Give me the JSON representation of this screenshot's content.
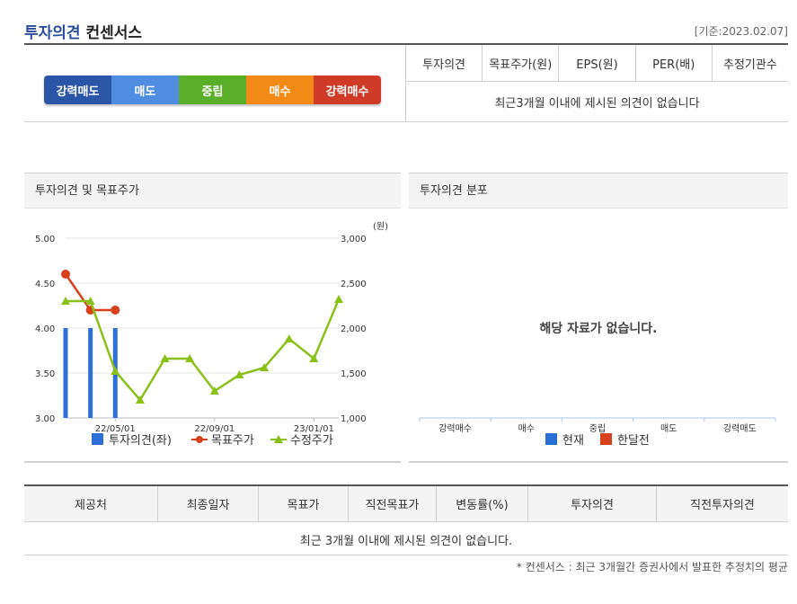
{
  "header": {
    "title_part1": "투자의견",
    "title_part2": "컨센서스",
    "date": "[기준:2023.02.07]"
  },
  "opinion_scale": [
    {
      "label": "강력매도",
      "color": "#2b56a8"
    },
    {
      "label": "매도",
      "color": "#4f8de0"
    },
    {
      "label": "중립",
      "color": "#5aae2a"
    },
    {
      "label": "매수",
      "color": "#f38a17"
    },
    {
      "label": "강력매수",
      "color": "#cf3b28"
    }
  ],
  "top_table": {
    "headers": [
      "투자의견",
      "목표주가(원)",
      "EPS(원)",
      "PER(배)",
      "추정기관수"
    ],
    "message": "최근3개월 이내에 제시된 의견이 없습니다"
  },
  "left_panel": {
    "title": "투자의견 및 목표주가"
  },
  "right_panel": {
    "title": "투자의견 분포",
    "no_data": "해당 자료가 없습니다."
  },
  "colors": {
    "opinion_bar": "#2f6fd8",
    "target_price": "#d8411c",
    "revised_price": "#8ac018",
    "dist_current": "#2a6fd6",
    "dist_prev_month": "#d8411c"
  },
  "chart_data": [
    {
      "type": "line",
      "y_left": {
        "ticks": [
          "5.00",
          "4.50",
          "4.00",
          "3.50",
          "3.00"
        ],
        "range": [
          3.0,
          5.0
        ]
      },
      "y_right": {
        "ticks": [
          "3,000",
          "2,500",
          "2,000",
          "1,500",
          "1,000"
        ],
        "range": [
          1000,
          3000
        ],
        "unit": "(원)"
      },
      "x_ticks": [
        "22/05/01",
        "22/09/01",
        "23/01/01"
      ],
      "x_tick_index": [
        2,
        6,
        10
      ],
      "legend": [
        "투자의견(좌)",
        "목표주가",
        "수정주가"
      ],
      "series": [
        {
          "name": "투자의견(좌)",
          "kind": "bar",
          "axis": "left",
          "index": [
            0,
            1,
            2
          ],
          "values": [
            4.0,
            4.0,
            4.0
          ]
        },
        {
          "name": "목표주가",
          "kind": "line",
          "axis": "right",
          "index": [
            0,
            1,
            2
          ],
          "values": [
            2600,
            2200,
            2200
          ]
        },
        {
          "name": "수정주가",
          "kind": "line",
          "axis": "right",
          "index": [
            0,
            1,
            2,
            3,
            4,
            5,
            6,
            7,
            8,
            9,
            10,
            11
          ],
          "values": [
            2300,
            2300,
            1520,
            1200,
            1660,
            1660,
            1300,
            1480,
            1560,
            1880,
            1660,
            2320
          ]
        }
      ],
      "x_count": 12
    },
    {
      "type": "bar",
      "categories": [
        "강력매수",
        "매수",
        "중립",
        "매도",
        "강력매도"
      ],
      "legend": [
        "현재",
        "한달전"
      ],
      "series": []
    }
  ],
  "bottom_table": {
    "headers": [
      "제공처",
      "최종일자",
      "목표가",
      "직전목표가",
      "변동률(%)",
      "투자의견",
      "직전투자의견"
    ],
    "message": "최근 3개월 이내에 제시된 의견이 없습니다."
  },
  "footnote": "* 컨센서스 : 최근 3개월간 증권사에서 발표한 추정치의 평균"
}
